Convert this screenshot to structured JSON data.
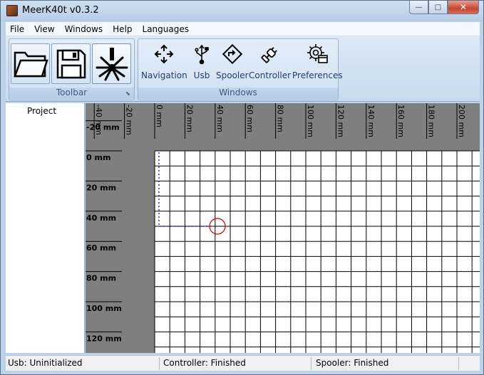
{
  "window": {
    "title": "MeerK40t v0.3.2",
    "min_glyph": "—",
    "max_glyph": "□",
    "close_glyph": "✕"
  },
  "menu": [
    "File",
    "View",
    "Windows",
    "Help",
    "Languages"
  ],
  "ribbon": {
    "toolbar_group_label": "Toolbar",
    "windows_group_label": "Windows",
    "windows_buttons": [
      {
        "label": "Navigation",
        "icon": "navigation-arrows-icon"
      },
      {
        "label": "Usb",
        "icon": "usb-icon"
      },
      {
        "label": "Spooler",
        "icon": "spooler-icon"
      },
      {
        "label": "Controller",
        "icon": "controller-plug-icon"
      },
      {
        "label": "Preferences",
        "icon": "preferences-gear-icon"
      }
    ],
    "toolbar_buttons": [
      {
        "icon": "open-folder-icon"
      },
      {
        "icon": "save-disk-icon"
      },
      {
        "icon": "laser-icon"
      }
    ]
  },
  "project": {
    "label": "Project"
  },
  "canvas": {
    "x_ticks": [
      "-40 mm",
      "-20 mm",
      "0 mm",
      "20 mm",
      "40 mm",
      "60 mm",
      "80 mm",
      "100 mm",
      "120 mm",
      "140 mm",
      "160 mm",
      "180 mm",
      "200 mm"
    ],
    "y_ticks": [
      "-20 mm",
      "0 mm",
      "20 mm",
      "40 mm",
      "60 mm",
      "80 mm",
      "100 mm",
      "120 mm"
    ],
    "background_color": "#7f7f7f",
    "bed_color": "#ffffff",
    "marker_color": "#cc0000",
    "path_color": "#0000aa"
  },
  "status": {
    "usb": "Usb: Uninitialized",
    "controller": "Controller: Finished",
    "spooler": "Spooler: Finished"
  }
}
